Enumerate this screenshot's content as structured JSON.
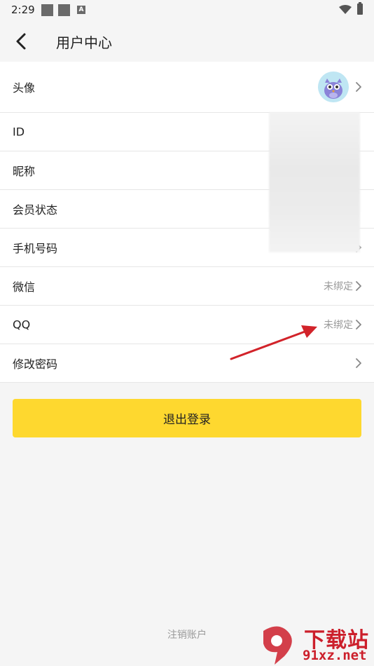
{
  "status_bar": {
    "time": "2:29",
    "icons": [
      "notification-square-icon",
      "notification-square-icon",
      "font-a-icon",
      "wifi-icon",
      "battery-icon"
    ]
  },
  "header": {
    "title": "用户中心",
    "back_icon": "chevron-left-icon"
  },
  "rows": [
    {
      "label": "头像",
      "value": ""
    },
    {
      "label": "ID",
      "value": ""
    },
    {
      "label": "昵称",
      "value": ""
    },
    {
      "label": "会员状态",
      "value": ""
    },
    {
      "label": "手机号码",
      "value": ""
    },
    {
      "label": "微信",
      "value": "未绑定"
    },
    {
      "label": "QQ",
      "value": "未绑定"
    },
    {
      "label": "修改密码",
      "value": ""
    }
  ],
  "logout_button": "退出登录",
  "cancel_account": "注销账户",
  "watermark": {
    "title": "下载站",
    "url": "91xz.net"
  },
  "colors": {
    "accent": "#fed82f",
    "annotation_arrow": "#d2232a",
    "watermark": "#cc1f2b"
  }
}
